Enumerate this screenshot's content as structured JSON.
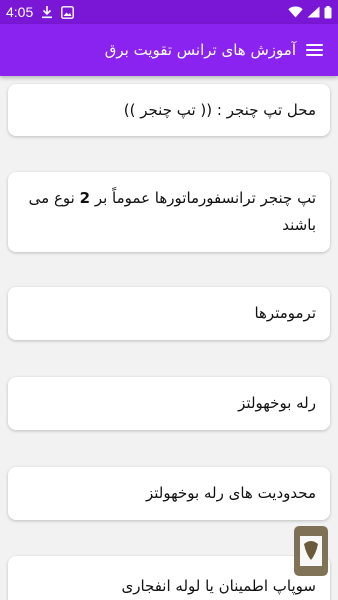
{
  "status_bar": {
    "time": "4:05",
    "left_icons": [
      "download-icon",
      "image-icon"
    ],
    "right_icons": [
      "wifi-icon",
      "signal-icon",
      "battery-icon"
    ]
  },
  "app_bar": {
    "title": "آموزش های ترانس تقویت برق",
    "menu_icon": "hamburger-menu-icon"
  },
  "colors": {
    "status_bar": "#7a17d6",
    "app_bar": "#8a22f0",
    "background": "#f2f2f2",
    "card": "#ffffff"
  },
  "list": {
    "items": [
      {
        "label": "محل تپ چنجر : (( تپ چنجر ))"
      },
      {
        "label_pre": "تپ چنجر ترانسفورماتورها عموماً بر ",
        "label_num": "2",
        "label_post": " نوع می باشند"
      },
      {
        "label": "ترمومترها"
      },
      {
        "label": "رله بوخهولتز"
      },
      {
        "label": "محدودیت های رله بوخهولتز"
      },
      {
        "label": "سوپاپ اطمینان یا لوله انفجاری"
      }
    ]
  },
  "floating_badge": {
    "icon": "store-badge-icon"
  }
}
